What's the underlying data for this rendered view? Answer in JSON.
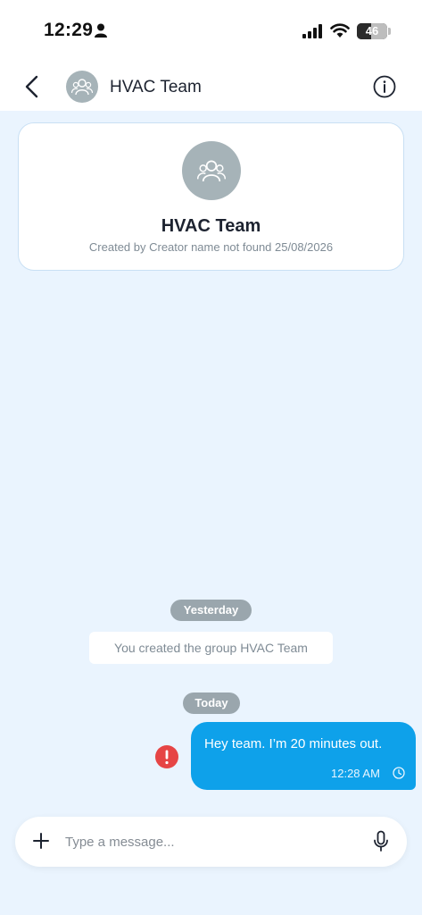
{
  "status_bar": {
    "time": "12:29",
    "battery_level": "46",
    "icons": [
      "person-icon",
      "signal-icon",
      "wifi-icon",
      "battery-icon"
    ]
  },
  "header": {
    "title": "HVAC Team",
    "icons": [
      "chevron-left-icon",
      "group-avatar-icon",
      "info-icon"
    ]
  },
  "group_card": {
    "title": "HVAC Team",
    "subtitle": "Created by Creator name not found 25/08/2026"
  },
  "chat": {
    "date_yesterday": "Yesterday",
    "system_message": "You created the group HVAC Team",
    "date_today": "Today",
    "messages": [
      {
        "text": "Hey team. I’m 20 minutes out.",
        "time": "12:28 AM",
        "status_icon": "clock-icon",
        "error_icon": "error-icon"
      }
    ]
  },
  "composer": {
    "placeholder": "Type a message...",
    "icons": [
      "plus-icon",
      "mic-icon"
    ]
  },
  "colors": {
    "background": "#eaf4fe",
    "bubble": "#0ea1ea",
    "error": "#e64545",
    "pill": "#9aa6ad",
    "avatar": "#a6b3b8"
  }
}
